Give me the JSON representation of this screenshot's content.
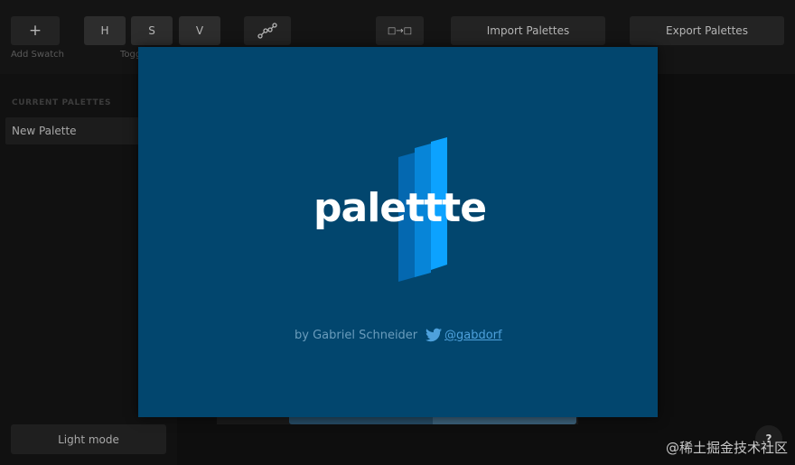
{
  "toolbar": {
    "add_label": "+",
    "add_caption": "Add Swatch",
    "hsv_buttons": [
      "H",
      "S",
      "V"
    ],
    "toggle_caption": "Toggl",
    "curve_icon": "curve-points-icon",
    "compare_icon": "swap-squares-icon",
    "compare_label": "□→□",
    "import_label": "Import Palettes",
    "export_label": "Export Palettes"
  },
  "sidebar": {
    "heading": "CURRENT PALETTES",
    "palettes": [
      "New Palette"
    ],
    "light_mode_label": "Light mode"
  },
  "modal": {
    "logo_text": "palettte",
    "credit": "by Gabriel Schneider",
    "twitter_icon": "twitter-bird-icon",
    "handle": "@gabdorf",
    "colors": {
      "background": "#02466e",
      "stripe_dark": "#0468b0",
      "stripe_mid": "#0785d8",
      "stripe_light": "#0ca2ff"
    }
  },
  "help": {
    "label": "?"
  },
  "watermark": "@稀土掘金技术社区"
}
